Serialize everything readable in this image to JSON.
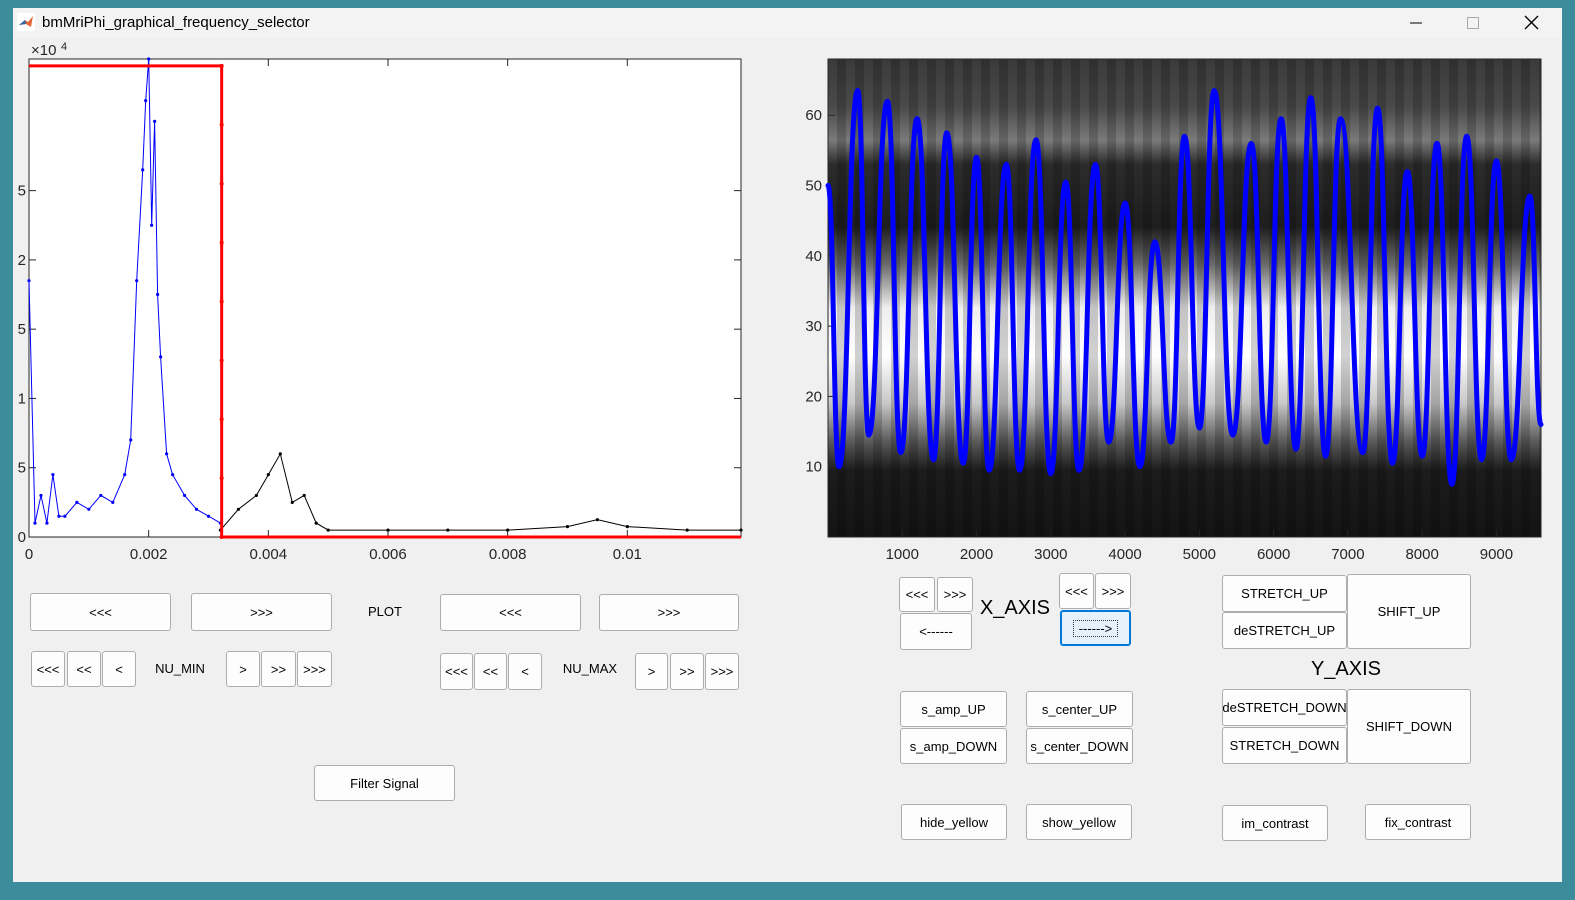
{
  "window": {
    "title": "bmMriPhi_graphical_frequency_selector",
    "controls": [
      "minimize-icon",
      "maximize-icon",
      "close-icon"
    ]
  },
  "chart_data": [
    {
      "type": "line",
      "name_hint": "frequency-spectrum",
      "exponent_label": "×10",
      "exponent_power": "4",
      "xlim": [
        0,
        0.0119
      ],
      "ylim": [
        0,
        6.9
      ],
      "xticks": [
        0,
        0.002,
        0.004,
        0.006,
        0.008,
        0.01
      ],
      "xtick_labels": [
        "0",
        "0.002",
        "0.004",
        "0.006",
        "0.008",
        "0.01"
      ],
      "yticks": [
        0,
        1,
        2,
        3,
        4,
        5
      ],
      "ytick_labels": [
        "0",
        "5",
        "1",
        "5",
        "2",
        "5"
      ],
      "selection": {
        "nu_min": 0,
        "nu_max": 0.00322,
        "level": 6.8
      },
      "series": [
        {
          "color": "#0000ff",
          "x": [
            0,
            0.0001,
            0.0002,
            0.0003,
            0.0004,
            0.0005,
            0.0006,
            0.0008,
            0.001,
            0.0012,
            0.0014,
            0.0016,
            0.0017,
            0.0018,
            0.0019,
            0.00195,
            0.002,
            0.00205,
            0.0021,
            0.00215,
            0.0022,
            0.0023,
            0.0024,
            0.0026,
            0.0028,
            0.003,
            0.0032
          ],
          "y": [
            3.7,
            0.2,
            0.6,
            0.2,
            0.9,
            0.3,
            0.3,
            0.5,
            0.4,
            0.6,
            0.5,
            0.9,
            1.4,
            3.7,
            5.3,
            6.3,
            6.9,
            4.5,
            6.0,
            3.5,
            2.6,
            1.2,
            0.9,
            0.6,
            0.4,
            0.3,
            0.2
          ]
        },
        {
          "color": "#000000",
          "x": [
            0.0032,
            0.0035,
            0.0038,
            0.004,
            0.0042,
            0.0044,
            0.0046,
            0.0048,
            0.005,
            0.006,
            0.007,
            0.008,
            0.009,
            0.0095,
            0.01,
            0.011,
            0.0119
          ],
          "y": [
            0.1,
            0.4,
            0.6,
            0.9,
            1.2,
            0.5,
            0.6,
            0.2,
            0.1,
            0.1,
            0.1,
            0.1,
            0.15,
            0.25,
            0.15,
            0.1,
            0.1
          ]
        }
      ]
    },
    {
      "type": "heatmap",
      "name_hint": "image-with-signal-overlay",
      "xlim": [
        0,
        9600
      ],
      "ylim": [
        0,
        68
      ],
      "xticks": [
        1000,
        2000,
        3000,
        4000,
        5000,
        6000,
        7000,
        8000,
        9000
      ],
      "yticks": [
        10,
        20,
        30,
        40,
        50,
        60
      ],
      "series": [
        {
          "color": "#0000ff",
          "x": [
            0,
            150,
            400,
            550,
            800,
            980,
            1200,
            1420,
            1600,
            1820,
            2000,
            2170,
            2400,
            2580,
            2800,
            3000,
            3200,
            3380,
            3600,
            3780,
            4000,
            4200,
            4400,
            4620,
            4800,
            5000,
            5200,
            5450,
            5700,
            5900,
            6100,
            6300,
            6500,
            6700,
            6900,
            7200,
            7400,
            7600,
            7800,
            8000,
            8200,
            8400,
            8600,
            8800,
            9000,
            9200,
            9450,
            9600
          ],
          "y": [
            50,
            10,
            63.5,
            14.5,
            62,
            12,
            59.5,
            11,
            57.5,
            10.5,
            54,
            9.5,
            53,
            9.5,
            56.5,
            9,
            50.5,
            9.5,
            53,
            13.5,
            47.5,
            10,
            42,
            13.5,
            57,
            15.5,
            63.5,
            14.5,
            56,
            13.5,
            59.5,
            12.5,
            62.5,
            11.5,
            59.5,
            12,
            61,
            10.5,
            52,
            11.5,
            56,
            7.5,
            57,
            11,
            53.5,
            11,
            48.5,
            16
          ]
        }
      ]
    }
  ],
  "left_panel": {
    "row1": {
      "fast_back": "<<<",
      "fast_fwd": ">>>",
      "plot_label": "PLOT",
      "fast_back_2": "<<<",
      "fast_fwd_2": ">>>"
    },
    "nu_min": {
      "l3": "<<<",
      "l2": "<<",
      "l1": "<",
      "label": "NU_MIN",
      "r1": ">",
      "r2": ">>",
      "r3": ">>>"
    },
    "nu_max": {
      "l3": "<<<",
      "l2": "<<",
      "l1": "<",
      "label": "NU_MAX",
      "r1": ">",
      "r2": ">>",
      "r3": ">>>"
    },
    "filter_button": "Filter Signal"
  },
  "right_panel": {
    "x_axis": {
      "left_group_l": "<<<",
      "left_group_r": ">>>",
      "left_arrow": "<------",
      "label": "X_AXIS",
      "right_group_l": "<<<",
      "right_group_r": ">>>",
      "right_arrow": "------>"
    },
    "y_axis": {
      "stretch_up": "STRETCH_UP",
      "destretch_up": "deSTRETCH_UP",
      "shift_up": "SHIFT_UP",
      "label": "Y_AXIS",
      "destretch_down": "deSTRETCH_DOWN",
      "stretch_down": "STRETCH_DOWN",
      "shift_down": "SHIFT_DOWN"
    },
    "signal": {
      "s_amp_up": "s_amp_UP",
      "s_center_up": "s_center_UP",
      "s_amp_down": "s_amp_DOWN",
      "s_center_down": "s_center_DOWN"
    },
    "display": {
      "hide_yellow": "hide_yellow",
      "show_yellow": "show_yellow",
      "im_contrast": "im_contrast",
      "fix_contrast": "fix_contrast"
    }
  }
}
